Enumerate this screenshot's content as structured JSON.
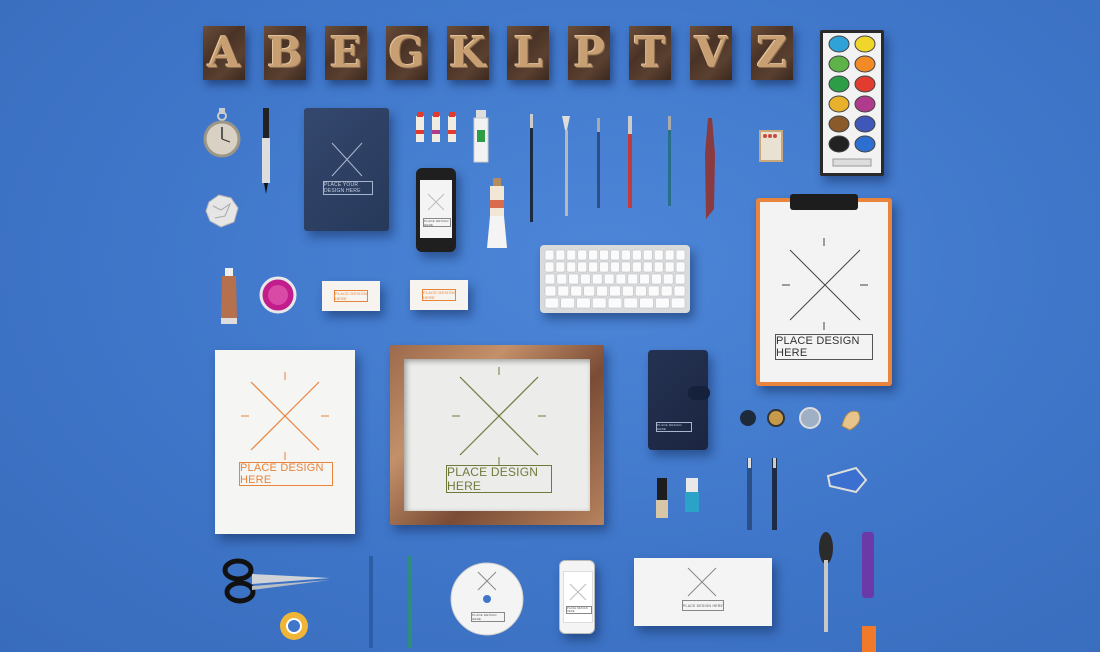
{
  "letters": [
    "A",
    "B",
    "E",
    "G",
    "K",
    "L",
    "P",
    "T",
    "V",
    "Z"
  ],
  "labels": {
    "frame": "PLACE DESIGN HERE",
    "paper": "PLACE DESIGN HERE",
    "clipboard": "PLACE DESIGN HERE",
    "notebook": "PLACE YOUR DESIGN HERE",
    "phone": "PLACE DESIGN HERE",
    "card1": "PLACE DESIGN HERE",
    "card2": "PLACE DESIGN HERE",
    "wallet": "PLACE DESIGN HERE",
    "cd": "PLACE DESIGN HERE",
    "iphone": "PLACE DESIGN HERE",
    "envelope": "PLACE DESIGN HERE"
  },
  "colors": {
    "background": "#3f76c9",
    "accent_orange": "#e8843b",
    "accent_olive": "#6f7a3a"
  },
  "paint_colors": [
    "#2fa3d8",
    "#f0d52a",
    "#5fb24a",
    "#f28a26",
    "#2d9e47",
    "#e23b2f",
    "#e8b12b",
    "#b03a8c",
    "#8a5a2b",
    "#3e57b8",
    "#222222",
    "#2d6fd0"
  ]
}
